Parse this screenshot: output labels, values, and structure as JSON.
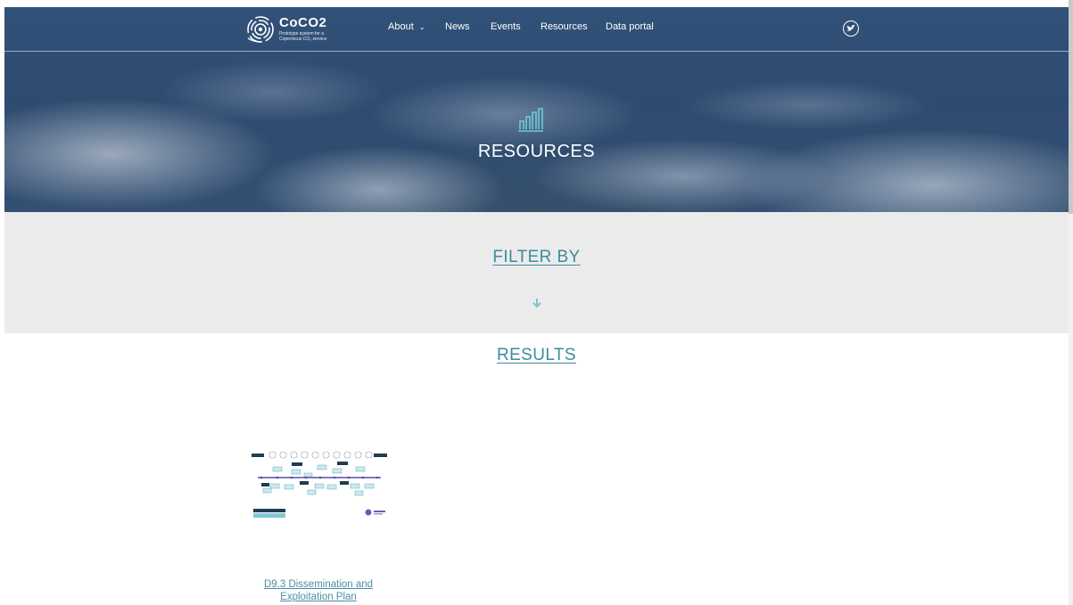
{
  "header": {
    "logo": {
      "name": "CoCO2",
      "tagline": "Prototype system for a Copernicus CO₂ service"
    },
    "nav": [
      {
        "label": "About",
        "has_dropdown": true
      },
      {
        "label": "News"
      },
      {
        "label": "Events"
      },
      {
        "label": "Resources"
      },
      {
        "label": "Data portal"
      }
    ],
    "social": {
      "icon": "twitter-icon"
    }
  },
  "hero": {
    "icon": "bar-chart-icon",
    "title": "RESOURCES"
  },
  "filter": {
    "title": "FILTER BY",
    "icon": "arrow-down-icon"
  },
  "results": {
    "title": "RESULTS",
    "items": [
      {
        "title": "D9.3 Dissemination and Exploitation Plan",
        "thumbnail": "timeline-diagram"
      }
    ]
  },
  "colors": {
    "accent": "#3f8a9f",
    "filter_bg": "#ebebeb",
    "hero_overlay": "#2f4f78"
  }
}
